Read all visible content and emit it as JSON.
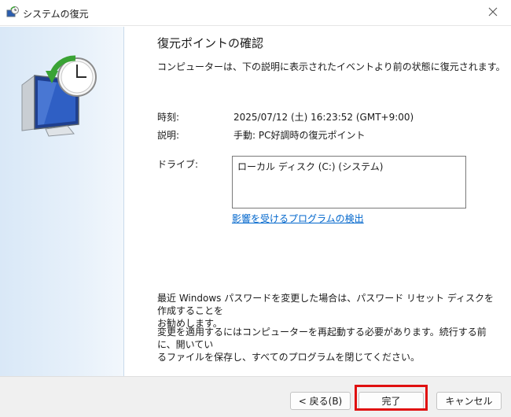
{
  "window": {
    "title": "システムの復元",
    "icons": {
      "app": "system-restore-icon",
      "close": "close-icon"
    }
  },
  "sidebar": {
    "icon": "system-restore-monitor-clock-icon"
  },
  "main": {
    "heading": "復元ポイントの確認",
    "subtitle": "コンピューターは、下の説明に表示されたイベントより前の状態に復元されます。",
    "time_label": "時刻:",
    "time_value": "2025/07/12 (土) 16:23:52 (GMT+9:00)",
    "description_label": "説明:",
    "description_value": "手動: PC好調時の復元ポイント",
    "drives_label": "ドライブ:",
    "drives": [
      "ローカル ディスク (C:) (システム)"
    ],
    "affected_programs_link": "影響を受けるプログラムの検出",
    "password_note_line1": "最近 Windows パスワードを変更した場合は、パスワード リセット ディスクを作成することを",
    "password_note_line2": "お勧めします。",
    "restart_note_line1": "変更を適用するにはコンピューターを再起動する必要があります。続行する前に、開いてい",
    "restart_note_line2": "るファイルを保存し、すべてのプログラムを閉じてください。"
  },
  "footer": {
    "back_label": "< 戻る(B)",
    "finish_label": "完了",
    "cancel_label": "キャンセル"
  },
  "colors": {
    "highlight": "#e01010",
    "link": "#0066cc",
    "sidebar": "#dde9f6"
  }
}
